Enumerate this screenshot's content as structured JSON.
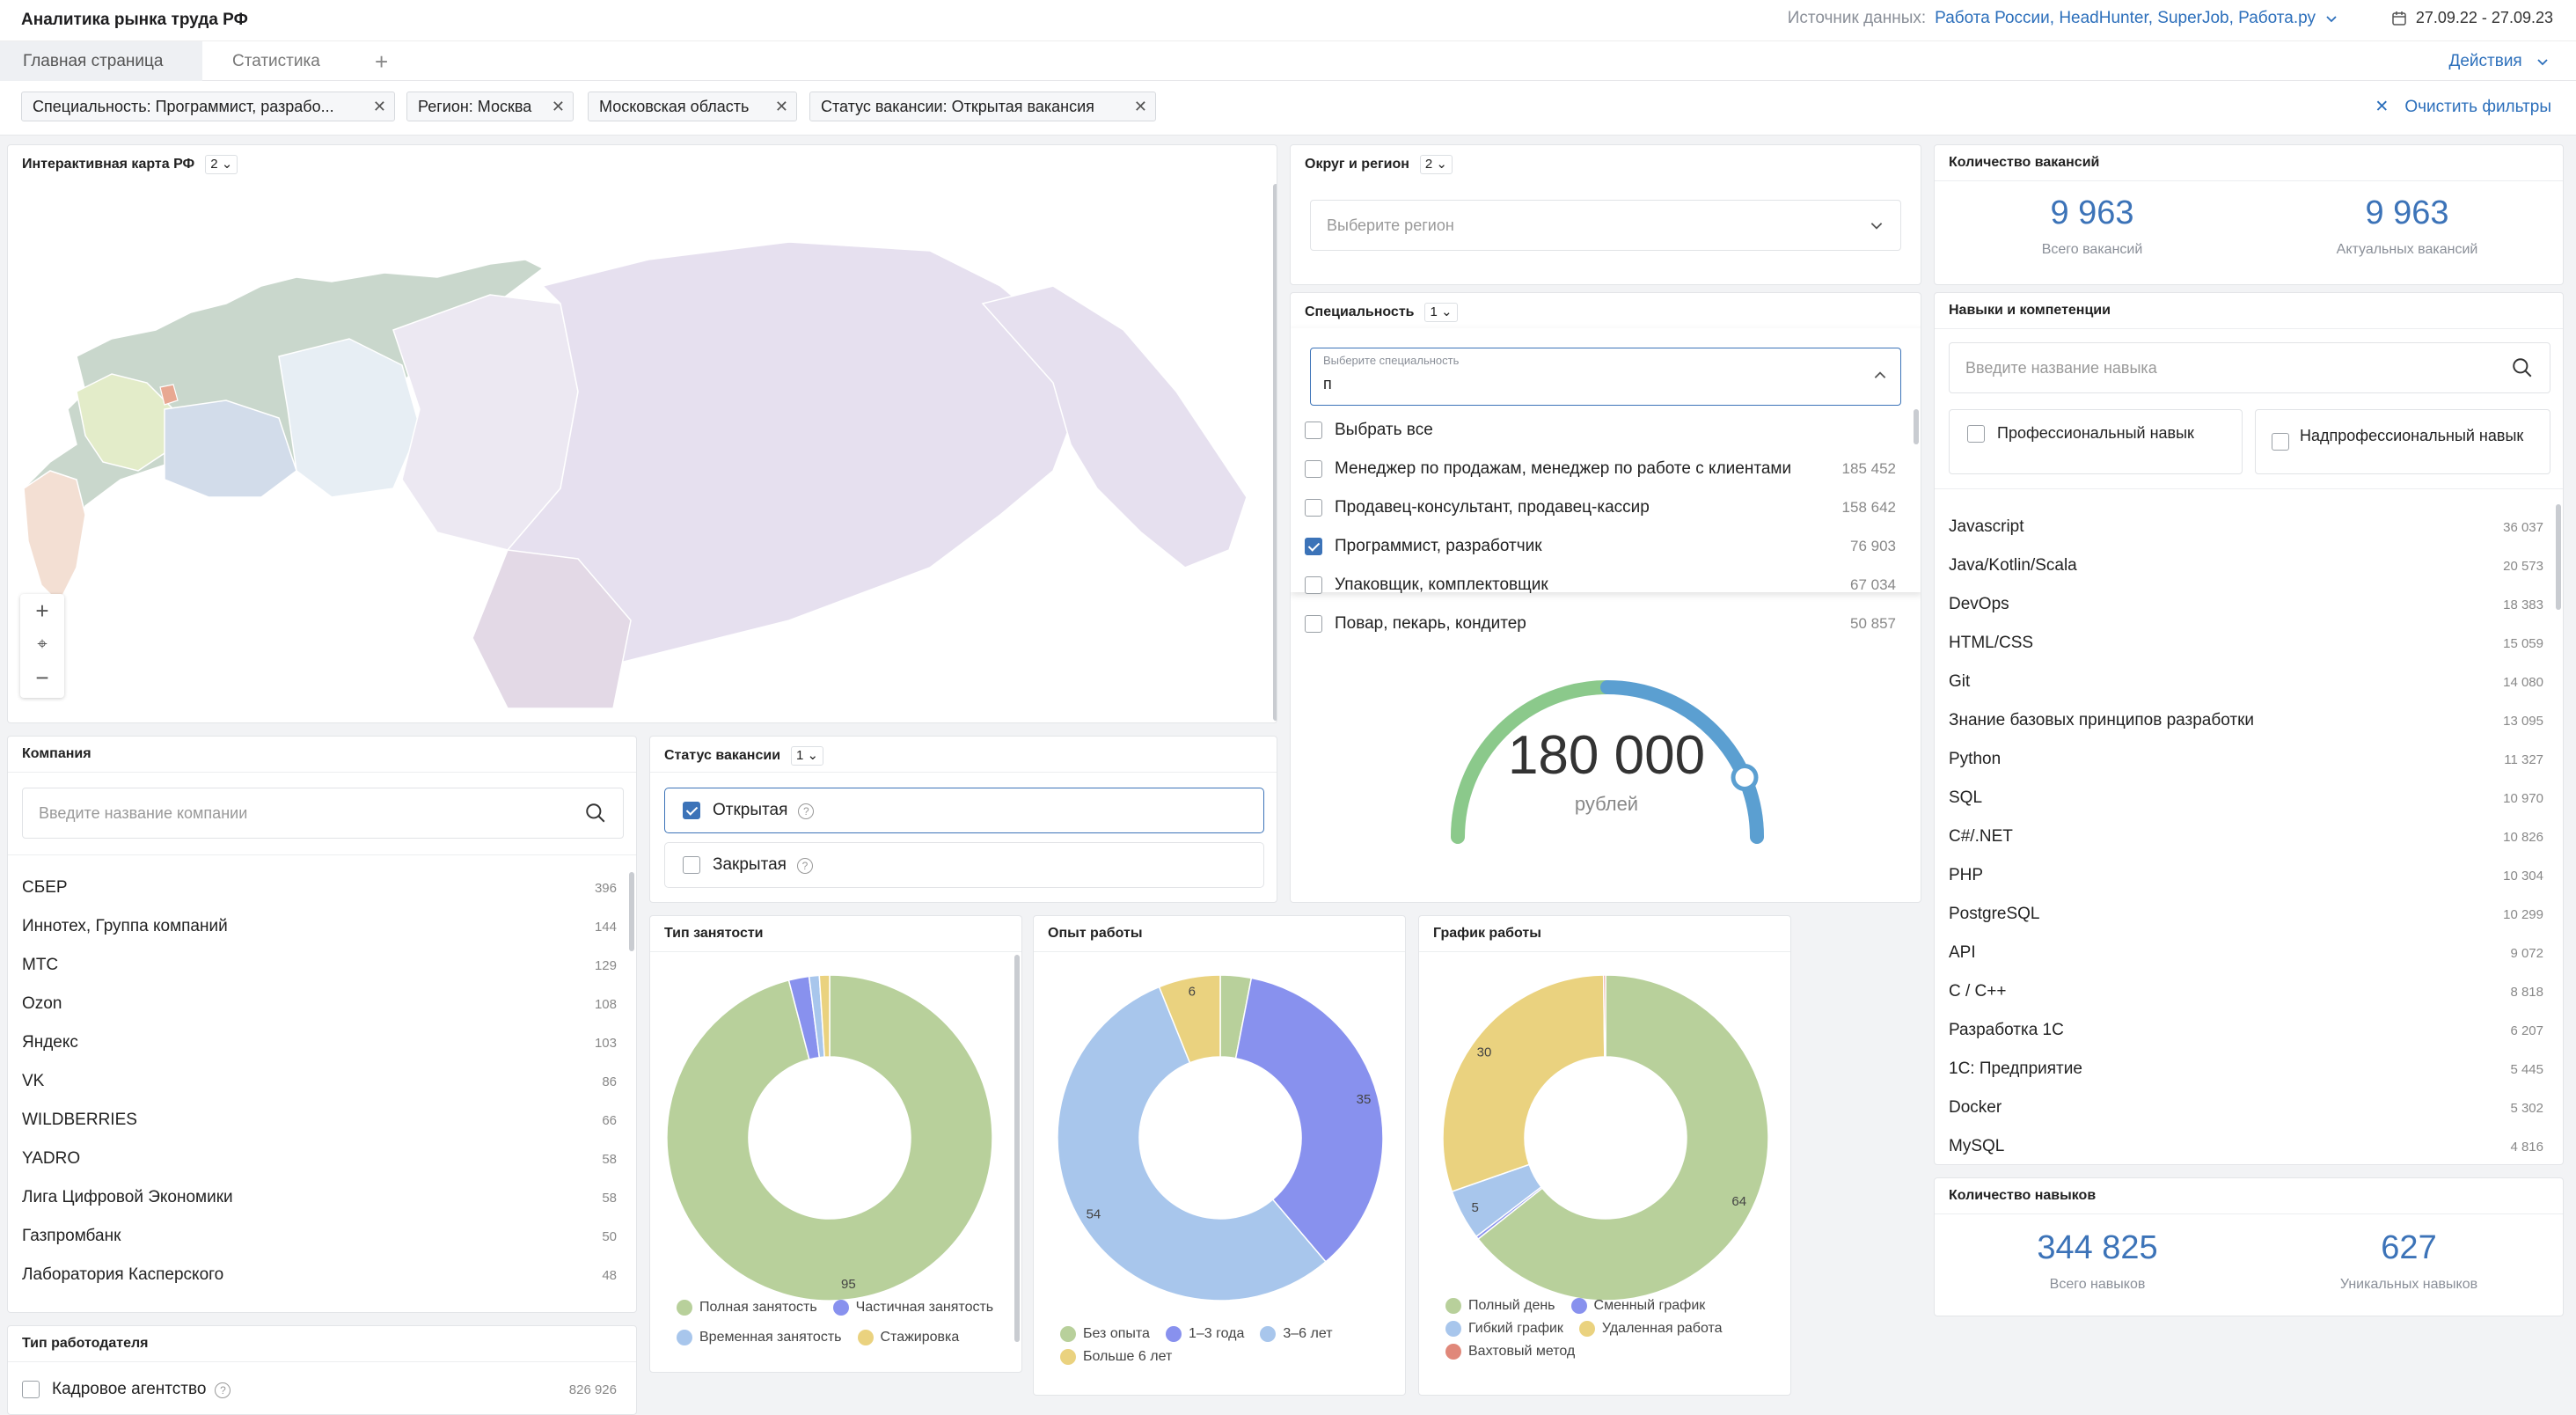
{
  "header": {
    "title": "Аналитика рынка труда РФ",
    "source_label": "Источник данных:",
    "source_value": "Работа России, HeadHunter, SuperJob, Работа.ру",
    "date_range": "27.09.22 - 27.09.23"
  },
  "tabs": [
    {
      "label": "Главная страница"
    },
    {
      "label": "Статистика"
    }
  ],
  "actions_label": "Действия",
  "filters": {
    "chips": [
      "Специальность: Программист, разрабо...",
      "Регион: Москва",
      "Московская область",
      "Статус вакансии: Открытая вакансия"
    ],
    "clear": "Очистить фильтры"
  },
  "map": {
    "title": "Интерактивная карта РФ",
    "badge": "2"
  },
  "region": {
    "title": "Округ и регион",
    "badge": "2",
    "placeholder": "Выберите регион"
  },
  "vacancies": {
    "title": "Количество вакансий",
    "total": "9 963",
    "total_label": "Всего вакансий",
    "actual": "9 963",
    "actual_label": "Актуальных вакансий"
  },
  "specialty": {
    "title": "Специальность",
    "badge": "1",
    "field_label": "Выберите специальность",
    "value": "п",
    "select_all": "Выбрать все",
    "options": [
      {
        "label": "Менеджер по продажам, менеджер по работе с клиентами",
        "count": "185 452",
        "checked": false
      },
      {
        "label": "Продавец-консультант, продавец-кассир",
        "count": "158 642",
        "checked": false
      },
      {
        "label": "Программист, разработчик",
        "count": "76 903",
        "checked": true
      },
      {
        "label": "Упаковщик, комплектовщик",
        "count": "67 034",
        "checked": false
      },
      {
        "label": "Повар, пекарь, кондитер",
        "count": "50 857",
        "checked": false
      }
    ]
  },
  "salary": {
    "value": "180 000",
    "unit": "рублей",
    "level": 0.87
  },
  "skills": {
    "title": "Навыки и компетенции",
    "placeholder": "Введите название навыка",
    "type1": "Профессиональный навык",
    "type2": "Надпрофессиональный навык",
    "items": [
      {
        "name": "Javascript",
        "count": "36 037"
      },
      {
        "name": "Java/Kotlin/Scala",
        "count": "20 573"
      },
      {
        "name": "DevOps",
        "count": "18 383"
      },
      {
        "name": "HTML/CSS",
        "count": "15 059"
      },
      {
        "name": "Git",
        "count": "14 080"
      },
      {
        "name": "Знание базовых принципов разработки",
        "count": "13 095"
      },
      {
        "name": "Python",
        "count": "11 327"
      },
      {
        "name": "SQL",
        "count": "10 970"
      },
      {
        "name": "C#/.NET",
        "count": "10 826"
      },
      {
        "name": "PHP",
        "count": "10 304"
      },
      {
        "name": "PostgreSQL",
        "count": "10 299"
      },
      {
        "name": "API",
        "count": "9 072"
      },
      {
        "name": "C / C++",
        "count": "8 818"
      },
      {
        "name": "Разработка 1С",
        "count": "6 207"
      },
      {
        "name": "1С: Предприятие",
        "count": "5 445"
      },
      {
        "name": "Docker",
        "count": "5 302"
      },
      {
        "name": "MySQL",
        "count": "4 816"
      }
    ]
  },
  "skills_count": {
    "title": "Количество навыков",
    "total": "344 825",
    "total_label": "Всего навыков",
    "unique": "627",
    "unique_label": "Уникальных навыков"
  },
  "company": {
    "title": "Компания",
    "placeholder": "Введите название компании",
    "items": [
      {
        "name": "СБЕР",
        "count": "396"
      },
      {
        "name": "Иннотех, Группа компаний",
        "count": "144"
      },
      {
        "name": "МТС",
        "count": "129"
      },
      {
        "name": "Ozon",
        "count": "108"
      },
      {
        "name": "Яндекс",
        "count": "103"
      },
      {
        "name": "VK",
        "count": "86"
      },
      {
        "name": "WILDBERRIES",
        "count": "66"
      },
      {
        "name": "YADRO",
        "count": "58"
      },
      {
        "name": "Лига Цифровой Экономики",
        "count": "58"
      },
      {
        "name": "Газпромбанк",
        "count": "50"
      },
      {
        "name": "Лаборатория Касперского",
        "count": "48"
      }
    ]
  },
  "status": {
    "title": "Статус вакансии",
    "badge": "1",
    "open": "Открытая",
    "closed": "Закрытая"
  },
  "employer": {
    "title": "Тип работодателя",
    "item": "Кадровое агентство",
    "count": "826 926"
  },
  "colors": {
    "accent": "#3c73b8",
    "green": "#b8d09b",
    "blue": "#8891ee",
    "lightblue": "#a8c6ec",
    "yellow": "#ead27f",
    "red": "#e0887a"
  },
  "chart_data": [
    {
      "type": "pie",
      "title": "Тип занятости",
      "series": [
        {
          "name": "Полная занятость",
          "value": 95
        },
        {
          "name": "Частичная занятость",
          "value": 2
        },
        {
          "name": "Временная занятость",
          "value": 1
        },
        {
          "name": "Стажировка",
          "value": 1
        }
      ],
      "legend": [
        "Полная занятость",
        "Частичная занятость",
        "Временная занятость",
        "Стажировка"
      ]
    },
    {
      "type": "pie",
      "title": "Опыт работы",
      "series": [
        {
          "name": "Без опыта",
          "value": 3
        },
        {
          "name": "1–3 года",
          "value": 35
        },
        {
          "name": "3–6 лет",
          "value": 54
        },
        {
          "name": "Больше 6 лет",
          "value": 6
        }
      ],
      "legend": [
        "Без опыта",
        "1–3 года",
        "3–6 лет",
        "Больше 6 лет"
      ]
    },
    {
      "type": "pie",
      "title": "График работы",
      "series": [
        {
          "name": "Полный день",
          "value": 64
        },
        {
          "name": "Сменный график",
          "value": 0.3
        },
        {
          "name": "Гибкий график",
          "value": 5
        },
        {
          "name": "Удаленная работа",
          "value": 30
        },
        {
          "name": "Вахтовый метод",
          "value": 0.2
        }
      ],
      "legend": [
        "Полный день",
        "Сменный график",
        "Гибкий график",
        "Удаленная работа",
        "Вахтовый метод"
      ]
    }
  ]
}
